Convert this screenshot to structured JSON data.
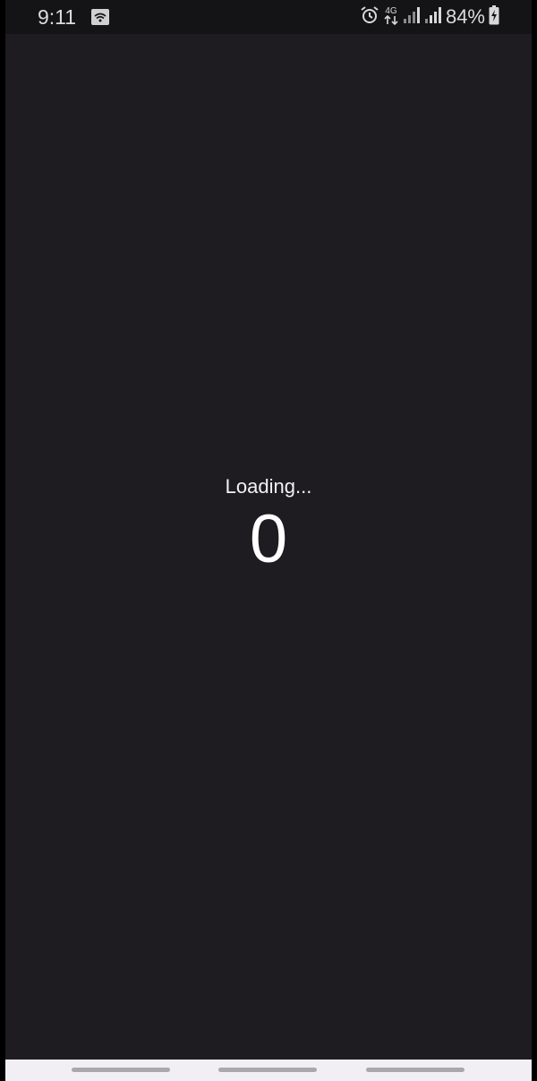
{
  "status_bar": {
    "time": "9:11",
    "left_icon": "image-notification-icon",
    "icons": [
      "alarm-icon",
      "4g-data-icon",
      "signal-icon",
      "signal-icon"
    ],
    "network_label": "4G",
    "battery_percent": "84%",
    "battery_icon": "battery-charging-icon"
  },
  "loading": {
    "label": "Loading...",
    "counter": "0"
  },
  "navigation_bar": {
    "handles": [
      "nav-handle-left",
      "nav-handle-center",
      "nav-handle-right"
    ]
  },
  "colors": {
    "background": "#1e1c20",
    "status_bar": "#141316",
    "text": "#ffffff",
    "nav_bar": "#f1eff3",
    "nav_pill": "#a9a8ad"
  }
}
